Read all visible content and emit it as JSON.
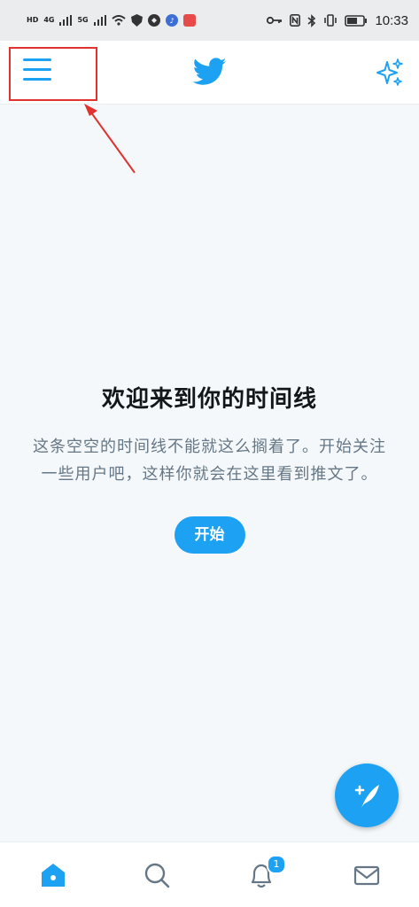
{
  "status_bar": {
    "time": "10:33",
    "network_left": "HD",
    "network_4g": "4G",
    "network_5g": "5G"
  },
  "app_bar": {
    "menu_icon": "hamburger-menu-icon",
    "logo_icon": "twitter-bird-icon",
    "sparkle_icon": "sparkle-icon"
  },
  "empty_state": {
    "title": "欢迎来到你的时间线",
    "description": "这条空空的时间线不能就这么搁着了。开始关注一些用户吧，这样你就会在这里看到推文了。",
    "start_button": "开始"
  },
  "fab": {
    "icon": "compose-tweet-icon"
  },
  "bottom_nav": {
    "items": [
      {
        "icon": "home-icon",
        "active": true
      },
      {
        "icon": "search-icon",
        "active": false
      },
      {
        "icon": "bell-icon",
        "active": false
      },
      {
        "icon": "mail-icon",
        "active": false
      }
    ],
    "notification_count": "1"
  },
  "colors": {
    "accent": "#1da1f2",
    "background": "#f5f8fa",
    "annotation": "#e0322f"
  }
}
